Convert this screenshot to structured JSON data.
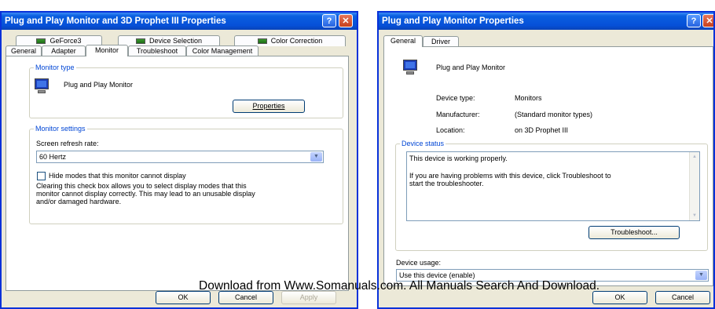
{
  "footer_text": "Download from Www.Somanuals.com. All Manuals Search And Download.",
  "left_dialog": {
    "title": "Plug and Play Monitor and 3D Prophet III Properties",
    "help_glyph": "?",
    "close_glyph": "✕",
    "tabs_row1": [
      "GeForce3",
      "Device Selection",
      "Color Correction"
    ],
    "tabs_row2": [
      "General",
      "Adapter",
      "Monitor",
      "Troubleshoot",
      "Color Management"
    ],
    "active_tab": "Monitor",
    "monitor_type": {
      "group_label": "Monitor type",
      "icon": "monitor-icon",
      "name": "Plug and Play Monitor",
      "properties_button": "Properties"
    },
    "monitor_settings": {
      "group_label": "Monitor settings",
      "refresh_label": "Screen refresh rate:",
      "refresh_value": "60 Hertz",
      "hide_modes_label": "Hide modes that this monitor cannot display",
      "hide_modes_checked": false,
      "description_line1": "Clearing this check box allows you to select display modes that this",
      "description_line2": "monitor cannot display correctly. This may lead to an unusable display",
      "description_line3": "and/or damaged hardware."
    },
    "buttons": {
      "ok": "OK",
      "cancel": "Cancel",
      "apply": "Apply"
    }
  },
  "right_dialog": {
    "title": "Plug and Play Monitor Properties",
    "help_glyph": "?",
    "close_glyph": "✕",
    "tabs": [
      "General",
      "Driver"
    ],
    "active_tab": "General",
    "device_name": "Plug and Play Monitor",
    "icon": "monitor-icon",
    "props": [
      {
        "label": "Device type:",
        "value": "Monitors"
      },
      {
        "label": "Manufacturer:",
        "value": "(Standard monitor types)"
      },
      {
        "label": "Location:",
        "value": "on 3D Prophet III"
      }
    ],
    "device_status": {
      "group_label": "Device status",
      "line1": "This device is working properly.",
      "line2": "If you are having problems with this device, click Troubleshoot to",
      "line3": "start the troubleshooter."
    },
    "troubleshoot_button": "Troubleshoot...",
    "device_usage_label": "Device usage:",
    "device_usage_value": "Use this device (enable)",
    "buttons": {
      "ok": "OK",
      "cancel": "Cancel"
    }
  }
}
